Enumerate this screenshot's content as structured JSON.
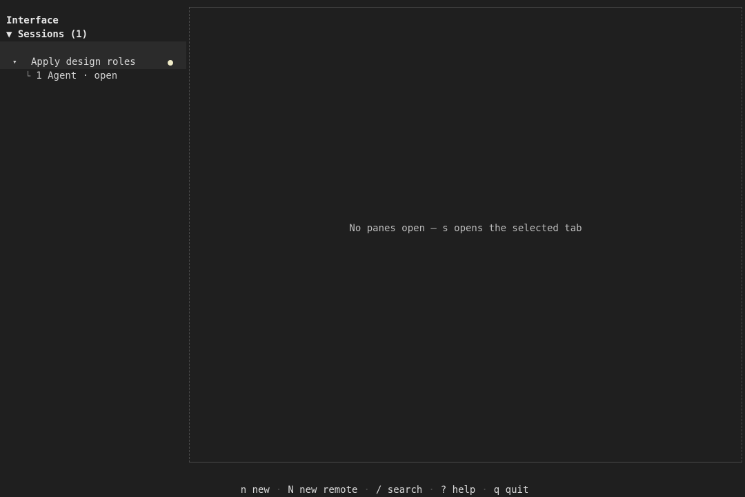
{
  "sidebar": {
    "app_title": "Interface",
    "section_header": "▼ Sessions (1)",
    "session": {
      "chevron": "▾",
      "title": "Apply design roles",
      "status_color": "#f0ecc8",
      "sub_branch": "└",
      "sub_label": "1 Agent · open"
    }
  },
  "main": {
    "empty_message": "No panes open — s opens the selected tab"
  },
  "footer": {
    "separator": "·",
    "shortcuts": [
      {
        "label": "n new"
      },
      {
        "label": "N new remote"
      },
      {
        "label": "/ search"
      },
      {
        "label": "? help"
      },
      {
        "label": "q quit"
      }
    ]
  }
}
